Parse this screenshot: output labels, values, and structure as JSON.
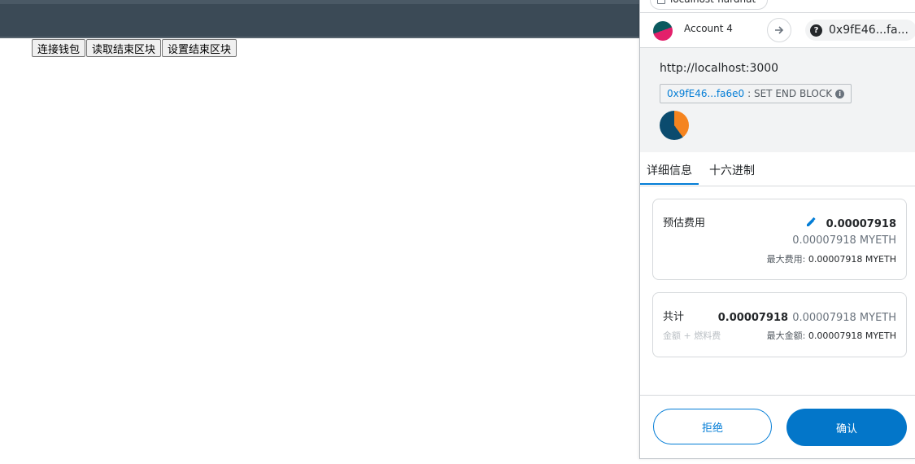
{
  "dapp": {
    "buttons": [
      "连接钱包",
      "读取结束区块",
      "设置结束区块"
    ]
  },
  "popup": {
    "origin": "localhost-hardhat",
    "account_name": "Account 4",
    "recipient_short": "0x9fE46...fa...",
    "site_url": "http://localhost:3000",
    "method_address": "0x9fE46...fa6e0",
    "method_name": ": SET END BLOCK",
    "tabs": [
      "详细信息",
      "十六进制"
    ],
    "fee": {
      "label": "预估费用",
      "amount": "0.00007918",
      "amount_eth": "0.00007918 MYETH",
      "max_label": "最大费用:",
      "max_value": "0.00007918 MYETH"
    },
    "total": {
      "label": "共计",
      "amount": "0.00007918",
      "amount_eth": "0.00007918 MYETH",
      "sub_label": "金额 + 燃料费",
      "max_label": "最大金额:",
      "max_value": "0.00007918 MYETH"
    },
    "reject_label": "拒绝",
    "confirm_label": "确认"
  },
  "colors": {
    "accent": "#037dd6",
    "confirm_bg": "#0376c9",
    "topbar": "#3b4a56"
  }
}
